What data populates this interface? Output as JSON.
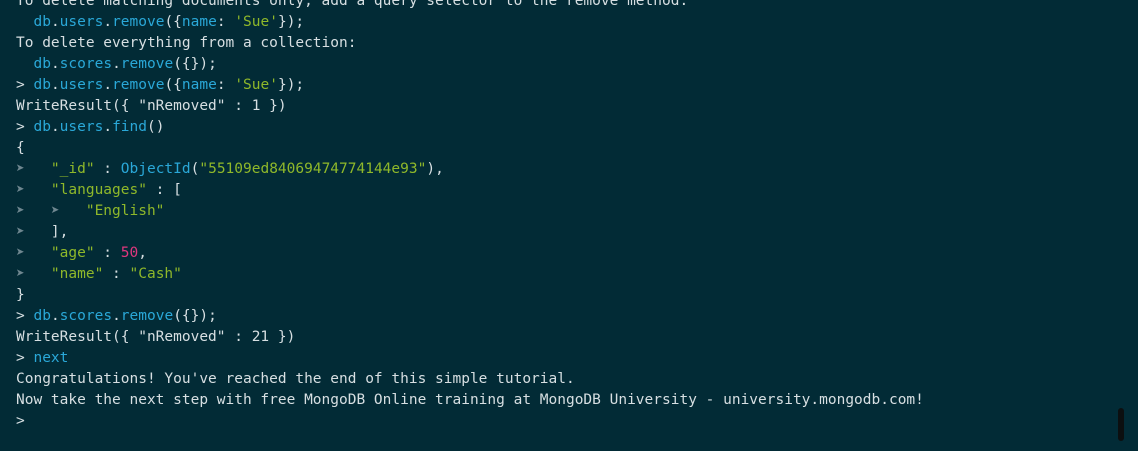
{
  "terminal": {
    "lines": [
      [
        {
          "t": "To delete matching documents only, add a query selector to the remove method:",
          "c": "plain"
        }
      ],
      [
        {
          "t": "  ",
          "c": "plain"
        },
        {
          "t": "db",
          "c": "db"
        },
        {
          "t": ".",
          "c": "plain"
        },
        {
          "t": "users",
          "c": "db"
        },
        {
          "t": ".",
          "c": "plain"
        },
        {
          "t": "remove",
          "c": "db"
        },
        {
          "t": "({",
          "c": "plain"
        },
        {
          "t": "name",
          "c": "db"
        },
        {
          "t": ": ",
          "c": "plain"
        },
        {
          "t": "'Sue'",
          "c": "str"
        },
        {
          "t": "});",
          "c": "plain"
        }
      ],
      [
        {
          "t": "To delete everything from a collection:",
          "c": "plain"
        }
      ],
      [
        {
          "t": "  ",
          "c": "plain"
        },
        {
          "t": "db",
          "c": "db"
        },
        {
          "t": ".",
          "c": "plain"
        },
        {
          "t": "scores",
          "c": "db"
        },
        {
          "t": ".",
          "c": "plain"
        },
        {
          "t": "remove",
          "c": "db"
        },
        {
          "t": "({});",
          "c": "plain"
        }
      ],
      [
        {
          "t": "> ",
          "c": "prompt"
        },
        {
          "t": "db",
          "c": "db"
        },
        {
          "t": ".",
          "c": "plain"
        },
        {
          "t": "users",
          "c": "db"
        },
        {
          "t": ".",
          "c": "plain"
        },
        {
          "t": "remove",
          "c": "db"
        },
        {
          "t": "({",
          "c": "plain"
        },
        {
          "t": "name",
          "c": "db"
        },
        {
          "t": ": ",
          "c": "plain"
        },
        {
          "t": "'Sue'",
          "c": "str"
        },
        {
          "t": "});",
          "c": "plain"
        }
      ],
      [
        {
          "t": "WriteResult({ \"nRemoved\" : 1 })",
          "c": "plain"
        }
      ],
      [
        {
          "t": "> ",
          "c": "prompt"
        },
        {
          "t": "db",
          "c": "db"
        },
        {
          "t": ".",
          "c": "plain"
        },
        {
          "t": "users",
          "c": "db"
        },
        {
          "t": ".",
          "c": "plain"
        },
        {
          "t": "find",
          "c": "db"
        },
        {
          "t": "()",
          "c": "plain"
        }
      ],
      [
        {
          "t": "{",
          "c": "plain"
        }
      ],
      [
        {
          "t": "➤   ",
          "c": "cont"
        },
        {
          "t": "\"_id\"",
          "c": "str"
        },
        {
          "t": " : ",
          "c": "plain"
        },
        {
          "t": "ObjectId",
          "c": "db"
        },
        {
          "t": "(",
          "c": "plain"
        },
        {
          "t": "\"55109ed84069474774144e93\"",
          "c": "str"
        },
        {
          "t": "),",
          "c": "plain"
        }
      ],
      [
        {
          "t": "➤   ",
          "c": "cont"
        },
        {
          "t": "\"languages\"",
          "c": "str"
        },
        {
          "t": " : [",
          "c": "plain"
        }
      ],
      [
        {
          "t": "➤   ➤   ",
          "c": "cont"
        },
        {
          "t": "\"English\"",
          "c": "str"
        }
      ],
      [
        {
          "t": "➤   ",
          "c": "cont"
        },
        {
          "t": "],",
          "c": "plain"
        }
      ],
      [
        {
          "t": "➤   ",
          "c": "cont"
        },
        {
          "t": "\"age\"",
          "c": "str"
        },
        {
          "t": " : ",
          "c": "plain"
        },
        {
          "t": "50",
          "c": "num"
        },
        {
          "t": ",",
          "c": "plain"
        }
      ],
      [
        {
          "t": "➤   ",
          "c": "cont"
        },
        {
          "t": "\"name\"",
          "c": "str"
        },
        {
          "t": " : ",
          "c": "plain"
        },
        {
          "t": "\"Cash\"",
          "c": "str"
        }
      ],
      [
        {
          "t": "}",
          "c": "plain"
        }
      ],
      [
        {
          "t": "> ",
          "c": "prompt"
        },
        {
          "t": "db",
          "c": "db"
        },
        {
          "t": ".",
          "c": "plain"
        },
        {
          "t": "scores",
          "c": "db"
        },
        {
          "t": ".",
          "c": "plain"
        },
        {
          "t": "remove",
          "c": "db"
        },
        {
          "t": "({});",
          "c": "plain"
        }
      ],
      [
        {
          "t": "WriteResult({ \"nRemoved\" : 21 })",
          "c": "plain"
        }
      ],
      [
        {
          "t": "> ",
          "c": "prompt"
        },
        {
          "t": "next",
          "c": "db"
        }
      ],
      [
        {
          "t": "Congratulations! You've reached the end of this simple tutorial.",
          "c": "plain"
        }
      ],
      [
        {
          "t": "Now take the next step with free MongoDB Online training at MongoDB University - university.mongodb.com!",
          "c": "plain"
        }
      ],
      [
        {
          "t": ">",
          "c": "prompt"
        }
      ]
    ]
  }
}
